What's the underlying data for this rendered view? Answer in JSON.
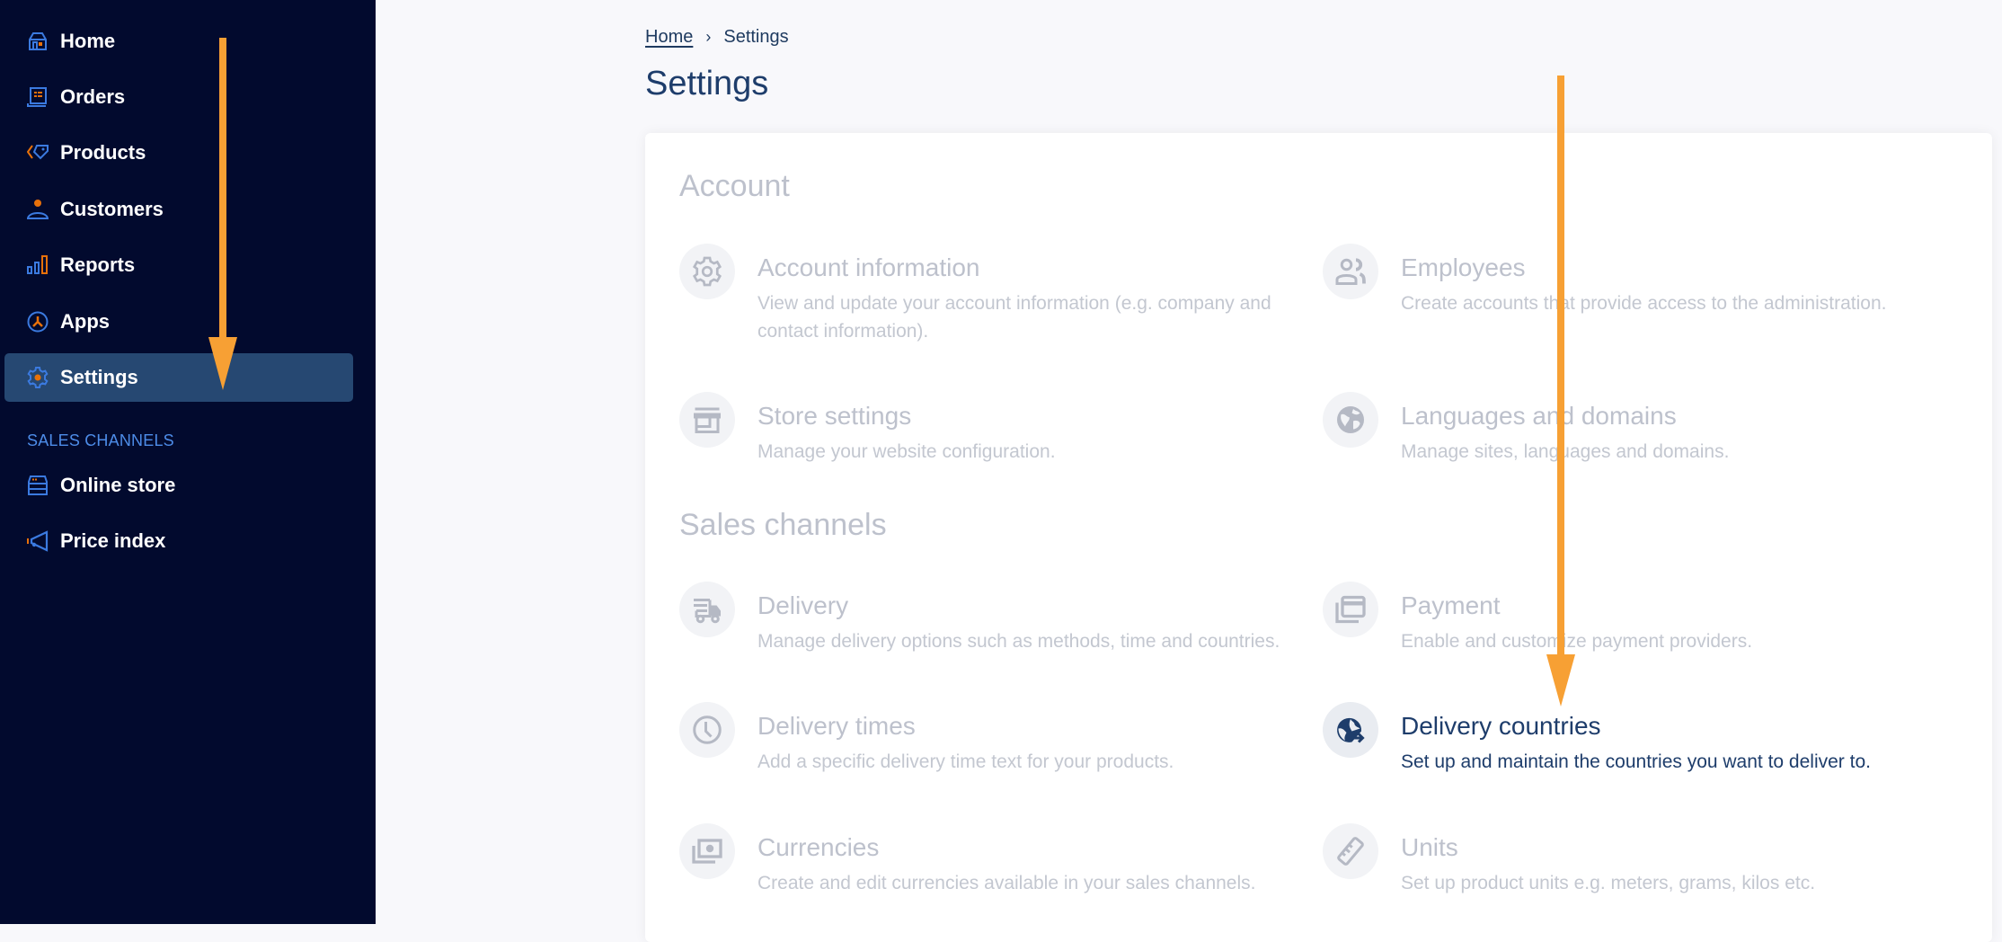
{
  "colors": {
    "sidebar_bg": "#020a2e",
    "sidebar_active_bg": "#264872",
    "icon_blue": "#3b7ae0",
    "icon_orange": "#e8710a",
    "annotation_arrow": "#f7a034",
    "title_navy": "#1e3d6b",
    "muted_text": "#bdc1cc"
  },
  "sidebar": {
    "items": [
      {
        "label": "Home",
        "icon": "home-icon"
      },
      {
        "label": "Orders",
        "icon": "orders-icon"
      },
      {
        "label": "Products",
        "icon": "tag-icon"
      },
      {
        "label": "Customers",
        "icon": "person-icon"
      },
      {
        "label": "Reports",
        "icon": "bar-chart-icon"
      },
      {
        "label": "Apps",
        "icon": "apps-icon"
      },
      {
        "label": "Settings",
        "icon": "gear-icon",
        "active": true
      }
    ],
    "section_label": "SALES CHANNELS",
    "channels": [
      {
        "label": "Online store",
        "icon": "store-icon"
      },
      {
        "label": "Price index",
        "icon": "megaphone-icon"
      }
    ]
  },
  "breadcrumb": {
    "home": "Home",
    "separator": "›",
    "current": "Settings"
  },
  "page_title": "Settings",
  "sections": [
    {
      "heading": "Account",
      "items": [
        {
          "title": "Account information",
          "desc": "View and update your account information (e.g. company and contact information).",
          "icon": "gear-icon"
        },
        {
          "title": "Employees",
          "desc": "Create accounts that provide access to the administration.",
          "icon": "users-icon"
        },
        {
          "title": "Store settings",
          "desc": "Manage your website configuration.",
          "icon": "storefront-icon"
        },
        {
          "title": "Languages and domains",
          "desc": "Manage sites, languages and domains.",
          "icon": "globe-icon"
        }
      ]
    },
    {
      "heading": "Sales channels",
      "items": [
        {
          "title": "Delivery",
          "desc": "Manage delivery options such as methods, time and countries.",
          "icon": "truck-icon"
        },
        {
          "title": "Payment",
          "desc": "Enable and customize payment providers.",
          "icon": "credit-card-icon"
        },
        {
          "title": "Delivery times",
          "desc": "Add a specific delivery time text for your products.",
          "icon": "clock-icon"
        },
        {
          "title": "Delivery countries",
          "desc": "Set up and maintain the countries you want to deliver to.",
          "icon": "globe-arrow-icon",
          "highlighted": true
        },
        {
          "title": "Currencies",
          "desc": "Create and edit currencies available in your sales channels.",
          "icon": "banknote-icon"
        },
        {
          "title": "Units",
          "desc": "Set up product units e.g. meters, grams, kilos etc.",
          "icon": "ruler-icon"
        }
      ]
    }
  ]
}
